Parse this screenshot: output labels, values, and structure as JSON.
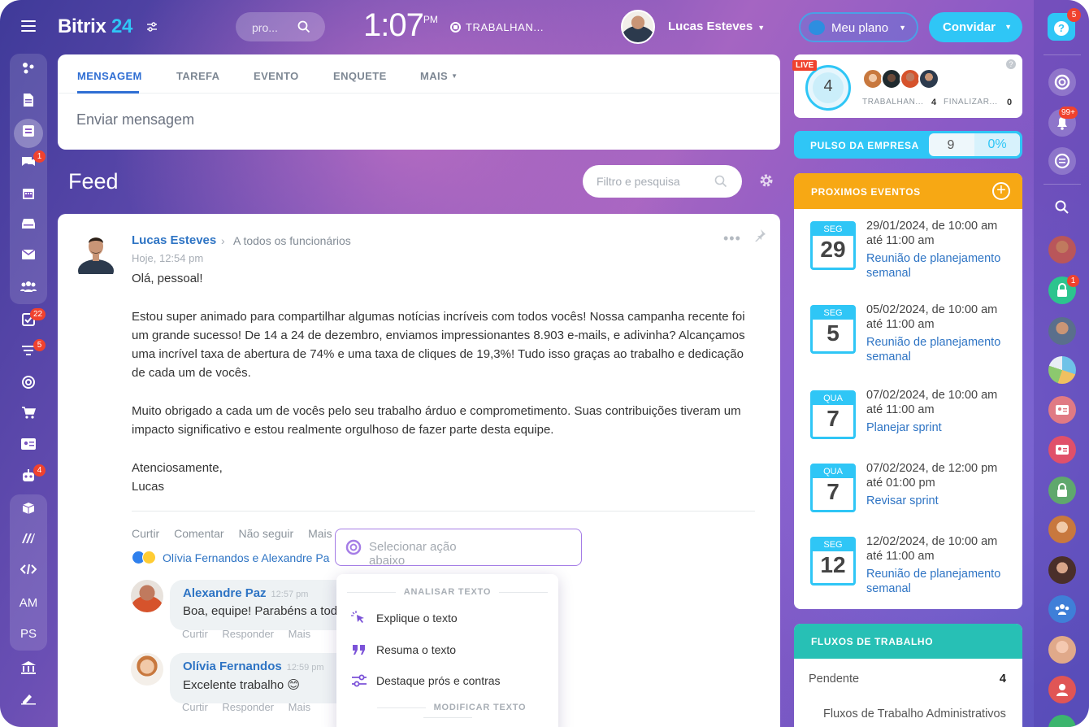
{
  "topbar": {
    "logo_text": "Bitrix",
    "logo_number": "24",
    "search_placeholder": "pro...",
    "clock_time": "1:07",
    "clock_ampm": "PM",
    "work_status": "TRABALHAN...",
    "user_name": "Lucas Esteves",
    "plan_label": "Meu plano",
    "invite_label": "Convidar",
    "help_badge": "5"
  },
  "left_sidebar": {
    "badges": {
      "chat": "1",
      "tasks": "22",
      "crm": "5",
      "bot": "4"
    },
    "text_items": [
      "AM",
      "PS"
    ]
  },
  "composer": {
    "tabs": [
      "MENSAGEM",
      "TAREFA",
      "EVENTO",
      "ENQUETE",
      "MAIS"
    ],
    "input_placeholder": "Enviar mensagem"
  },
  "feed": {
    "title": "Feed",
    "filter_placeholder": "Filtro e pesquisa"
  },
  "post": {
    "author": "Lucas Esteves",
    "destination": "A todos os funcionários",
    "time": "Hoje, 12:54 pm",
    "paragraphs": [
      "Olá, pessoal!",
      "Estou super animado para compartilhar algumas notícias incríveis com todos vocês! Nossa campanha recente foi um grande sucesso! De 14 a 24 de dezembro, enviamos impressionantes 8.903 e-mails, e adivinha? Alcançamos uma incrível taxa de abertura de 74% e uma taxa de cliques de 19,3%! Tudo isso graças ao trabalho e dedicação de cada um de vocês.",
      "Muito obrigado a cada um de vocês pelo seu trabalho árduo e comprometimento. Suas contribuições tiveram um impacto significativo e estou realmente orgulhoso de fazer parte desta equipe."
    ],
    "signoff_1": "Atenciosamente,",
    "signoff_2": "Lucas",
    "actions": [
      "Curtir",
      "Comentar",
      "Não seguir",
      "Mais"
    ],
    "reactions_text": "Olívia Fernandos e Alexandre Pa",
    "comments": [
      {
        "author": "Alexandre Paz",
        "time": "12:57 pm",
        "text": "Boa, equipe! Parabéns a tod",
        "actions": [
          "Curtir",
          "Responder",
          "Mais"
        ]
      },
      {
        "author": "Olívia Fernandos",
        "time": "12:59 pm",
        "text": "Excelente trabalho 😊",
        "actions": [
          "Curtir",
          "Responder",
          "Mais"
        ]
      }
    ]
  },
  "ai_popup": {
    "input_placeholder": "Selecionar ação abaixo",
    "section_1": "ANALISAR TEXTO",
    "items": [
      "Explique o texto",
      "Resuma o texto",
      "Destaque prós e contras"
    ],
    "section_2": "MODIFICAR TEXTO"
  },
  "live_widget": {
    "live_tag": "LIVE",
    "count": "4",
    "working_label": "TRABALHAN...",
    "working_count": "4",
    "finished_label": "FINALIZAR...",
    "finished_count": "0"
  },
  "pulse": {
    "label": "PULSO DA EMPRESA",
    "value": "9",
    "percent": "0%"
  },
  "events": {
    "title": "PROXIMOS EVENTOS",
    "items": [
      {
        "dow": "SEG",
        "day": "29",
        "when": "29/01/2024, de 10:00 am até 11:00 am",
        "title": "Reunião de planejamento semanal"
      },
      {
        "dow": "SEG",
        "day": "5",
        "when": "05/02/2024, de 10:00 am até 11:00 am",
        "title": "Reunião de planejamento semanal"
      },
      {
        "dow": "QUA",
        "day": "7",
        "when": "07/02/2024, de 10:00 am até 11:00 am",
        "title": "Planejar sprint"
      },
      {
        "dow": "QUA",
        "day": "7",
        "when": "07/02/2024, de 12:00 pm até 01:00 pm",
        "title": "Revisar sprint"
      },
      {
        "dow": "SEG",
        "day": "12",
        "when": "12/02/2024, de 10:00 am até 11:00 am",
        "title": "Reunião de planejamento semanal"
      }
    ]
  },
  "workflows": {
    "title": "FLUXOS DE TRABALHO",
    "pending_label": "Pendente",
    "pending_count": "4",
    "item": "Fluxos de Trabalho Administrativos"
  },
  "right_rail": {
    "notifications_badge": "99+",
    "lock_badge": "1"
  },
  "colors": {
    "accent_blue": "#2fc6f6",
    "link_blue": "#2e74c4",
    "events_orange": "#f7a814",
    "workflows_teal": "#27c0b5",
    "badge_red": "#f0422e",
    "ai_purple": "#a57de6"
  }
}
